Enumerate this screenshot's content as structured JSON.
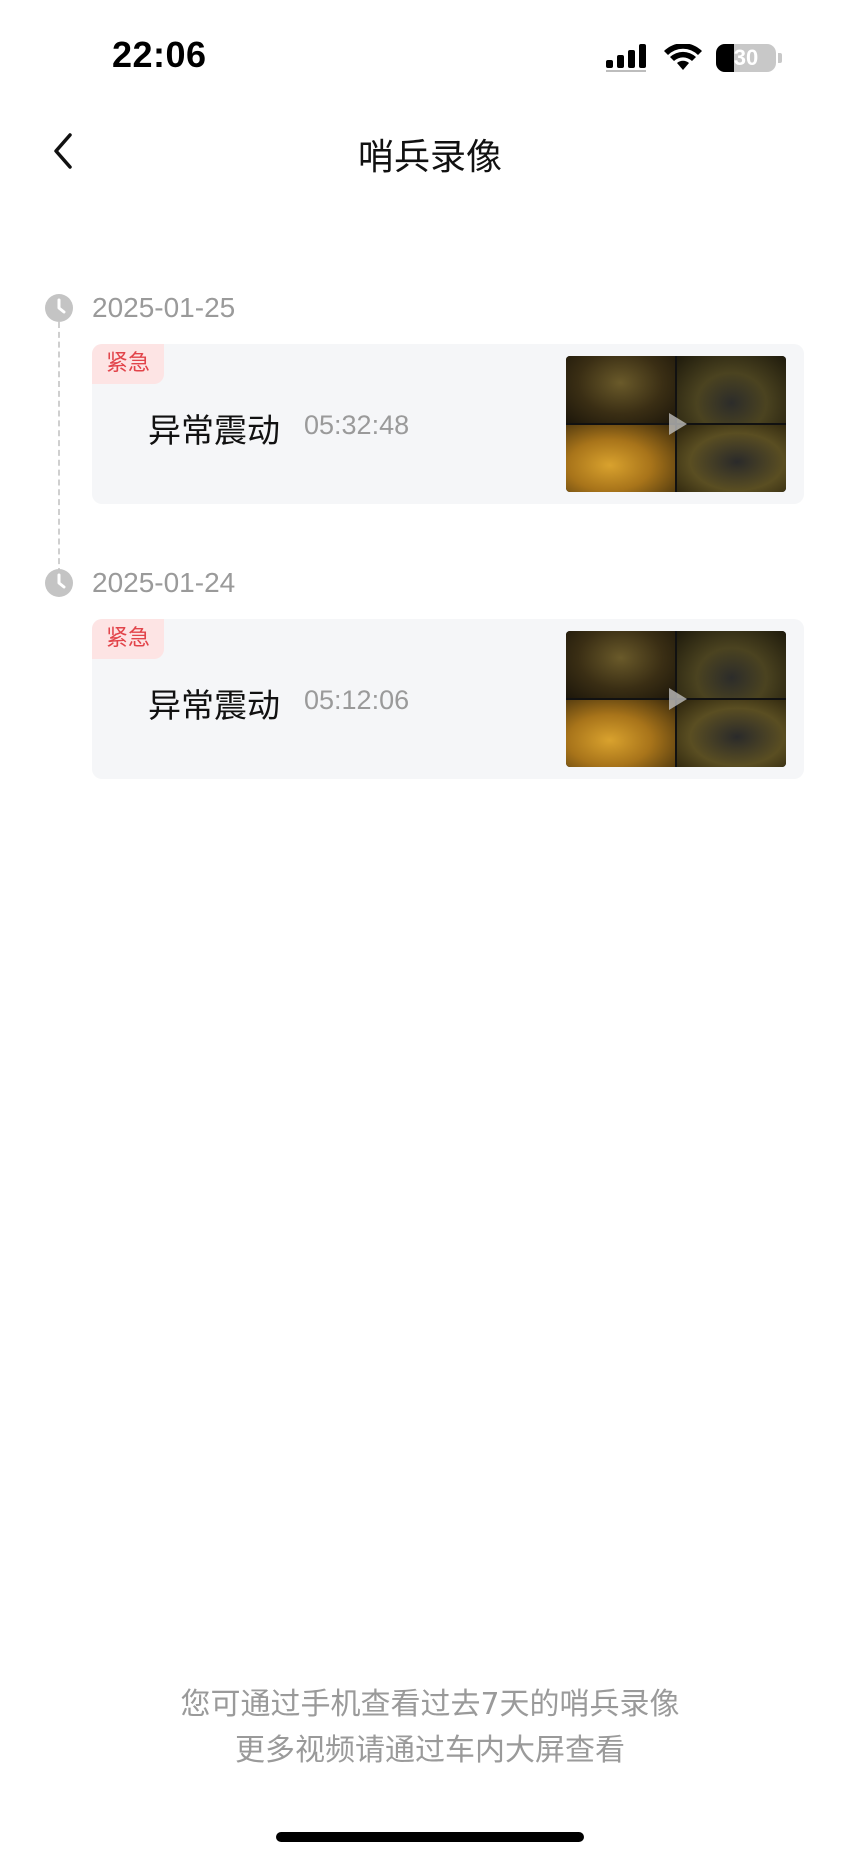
{
  "status_bar": {
    "time": "22:06",
    "battery_level": "30",
    "battery_fraction": 0.3,
    "icons": [
      "signal-icon",
      "wifi-icon",
      "battery-icon"
    ]
  },
  "nav": {
    "back_icon": "chevron-left-icon",
    "title": "哨兵录像"
  },
  "records": [
    {
      "date": "2025-01-25",
      "badge": "紧急",
      "event": "异常震动",
      "time": "05:32:48"
    },
    {
      "date": "2025-01-24",
      "badge": "紧急",
      "event": "异常震动",
      "time": "05:12:06"
    }
  ],
  "footer": {
    "line1": "您可通过手机查看过去7天的哨兵录像",
    "line2": "更多视频请通过车内大屏查看"
  },
  "colors": {
    "badge_text": "#e2444a",
    "badge_bg": "#fde4e4",
    "card_bg": "#f5f6f8",
    "muted_text": "#9a9a9a"
  }
}
